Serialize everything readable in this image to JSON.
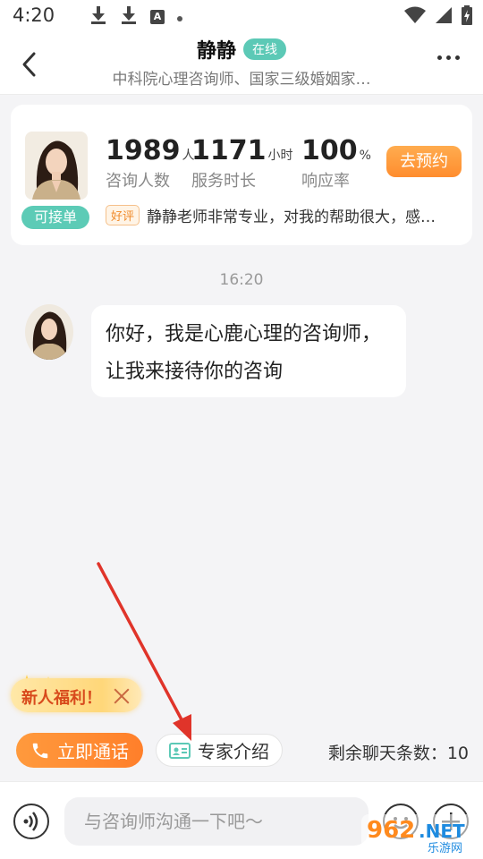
{
  "status_bar": {
    "time": "4:20"
  },
  "header": {
    "title": "静静",
    "online_badge": "在线",
    "subtitle": "中科院心理咨询师、国家三级婚姻家…"
  },
  "profile": {
    "accept_badge": "可接单",
    "stats": [
      {
        "value": "1989",
        "unit": "人",
        "label": "咨询人数"
      },
      {
        "value": "1171",
        "unit": "小时",
        "label": "服务时长"
      },
      {
        "value": "100",
        "unit": "%",
        "label": "响应率"
      }
    ],
    "book_button": "去预约",
    "review_tag": "好评",
    "review_text": "静静老师非常专业，对我的帮助很大，感…"
  },
  "chat": {
    "time": "16:20",
    "message": "你好，我是心鹿心理的咨询师，让我来接待你的咨询"
  },
  "promo": {
    "label": "新人福利！"
  },
  "actions": {
    "call_button": "立即通话",
    "intro_button": "专家介绍",
    "remaining": "剩余聊天条数：10"
  },
  "input": {
    "placeholder": "与咨询师沟通一下吧～"
  },
  "watermark": {
    "text1": "962",
    "text2": ".NET",
    "text3": "乐游网"
  },
  "colors": {
    "accent_green": "#5cc9b6",
    "accent_orange": "#ff8d2e",
    "arrow_red": "#e0342a"
  }
}
